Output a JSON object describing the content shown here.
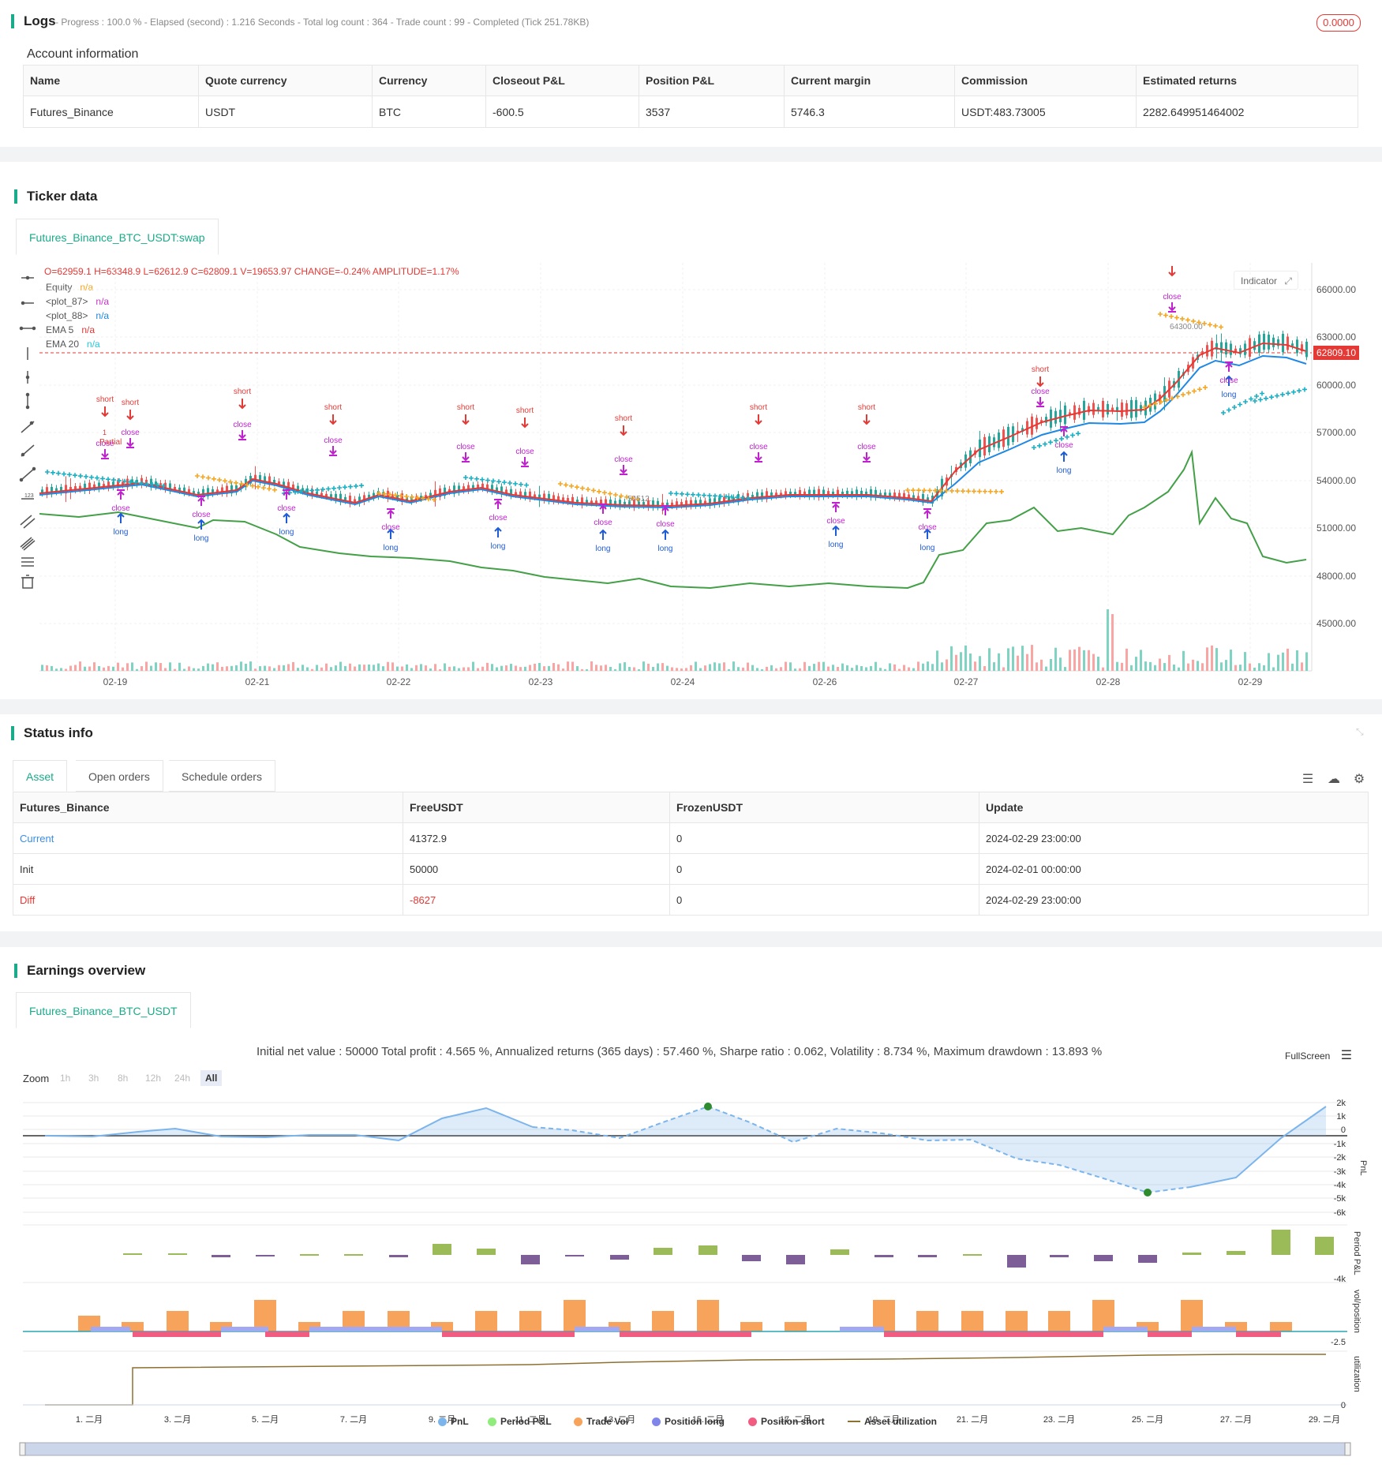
{
  "logs": {
    "title": "Logs",
    "status": "- Progress : 100.0 % - Elapsed (second) : 1.216 Seconds - Total log count : 364 - Trade count : 99 - Completed (Tick 251.78KB)",
    "badge": "0.0000"
  },
  "account": {
    "title": "Account information",
    "headers": [
      "Name",
      "Quote currency",
      "Currency",
      "Closeout P&L",
      "Position P&L",
      "Current margin",
      "Commission",
      "Estimated returns"
    ],
    "row": [
      "Futures_Binance",
      "USDT",
      "BTC",
      "-600.5",
      "3537",
      "5746.3",
      "USDT:483.73005",
      "2282.649951464002"
    ]
  },
  "ticker": {
    "title": "Ticker data",
    "tab": "Futures_Binance_BTC_USDT:swap",
    "ohlc": {
      "o_label": "O=",
      "o": "62959.1",
      "h_label": "H=",
      "h": "63348.9",
      "l_label": "L=",
      "l": "62612.9",
      "c_label": "C=",
      "c": "62809.1",
      "v_label": "V=",
      "v": "19653.97",
      "chg_label": "CHANGE=",
      "chg": "-0.24%",
      "amp_label": "AMPLITUDE=",
      "amp": "1.17%"
    },
    "legend": [
      {
        "name": "Equity",
        "value": "n/a",
        "color": "#f5a623"
      },
      {
        "name": "<plot_87>",
        "value": "n/a",
        "color": "#cc33cc"
      },
      {
        "name": "<plot_88>",
        "value": "n/a",
        "color": "#1e88e5"
      },
      {
        "name": "EMA 5",
        "value": "n/a",
        "color": "#e53935"
      },
      {
        "name": "EMA 20",
        "value": "n/a",
        "color": "#26c6da"
      }
    ],
    "indicator_btn": "Indicator",
    "price_ticks": [
      "66000.00",
      "63000.00",
      "60000.00",
      "57000.00",
      "54000.00",
      "51000.00",
      "48000.00",
      "45000.00"
    ],
    "last_price": "62809.10",
    "x_ticks": [
      "02-19",
      "02-21",
      "02-22",
      "02-23",
      "02-24",
      "02-26",
      "02-27",
      "02-28",
      "02-29"
    ],
    "hi_label": "64300.00",
    "lo_label": "50512.",
    "sig_short": "short",
    "sig_long": "long",
    "sig_close": "close",
    "sig_partial": "Partial",
    "sig_one": "1"
  },
  "status": {
    "title": "Status info",
    "tabs": [
      "Asset",
      "Open orders",
      "Schedule orders"
    ],
    "headers": [
      "Futures_Binance",
      "FreeUSDT",
      "FrozenUSDT",
      "Update"
    ],
    "rows": [
      [
        "Current",
        "41372.9",
        "0",
        "2024-02-29 23:00:00"
      ],
      [
        "Init",
        "50000",
        "0",
        "2024-02-01 00:00:00"
      ],
      [
        "Diff",
        "-8627",
        "0",
        "2024-02-29 23:00:00"
      ]
    ]
  },
  "earnings": {
    "title": "Earnings overview",
    "tab": "Futures_Binance_BTC_USDT",
    "summary": "Initial net value : 50000 Total profit : 4.565 %, Annualized returns (365 days) : 57.460 %, Sharpe ratio : 0.062, Volatility : 8.734 %, Maximum drawdown : 13.893 %",
    "fullscreen": "FullScreen",
    "zoom_label": "Zoom",
    "zoom_options": [
      "1h",
      "3h",
      "8h",
      "12h",
      "24h",
      "All"
    ],
    "pnl_ticks": [
      "2k",
      "1k",
      "0",
      "-1k",
      "-2k",
      "-3k",
      "-4k",
      "-5k",
      "-6k"
    ],
    "period_tick": "-4k",
    "vol_tick": "-2.5",
    "util_tick": "0",
    "axis_pnl": "PnL",
    "axis_period": "Period P&L",
    "axis_vol": "vol/position",
    "axis_util": "utilization",
    "x_ticks": [
      "1. 二月",
      "3. 二月",
      "5. 二月",
      "7. 二月",
      "9. 二月",
      "11. 二月",
      "13. 二月",
      "15. 二月",
      "17. 二月",
      "19. 二月",
      "21. 二月",
      "23. 二月",
      "25. 二月",
      "27. 二月",
      "29. 二月"
    ],
    "legend": [
      {
        "name": "PnL",
        "color": "#7cb5ec"
      },
      {
        "name": "Period P&L",
        "color": "#90ed7d"
      },
      {
        "name": "Trade Vol",
        "color": "#f7a35c"
      },
      {
        "name": "Position long",
        "color": "#8085e9"
      },
      {
        "name": "Position short",
        "color": "#f15c80"
      },
      {
        "name": "Asset utilization",
        "color": "#8d7032"
      }
    ]
  }
}
